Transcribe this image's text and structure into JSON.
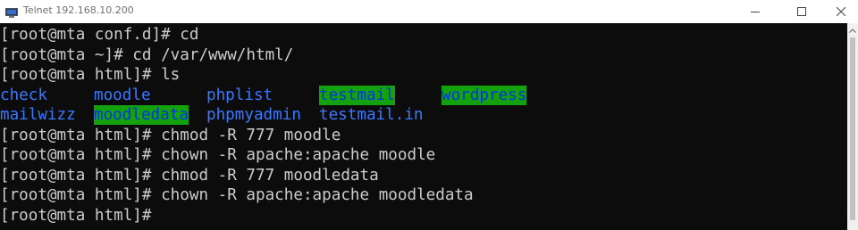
{
  "window": {
    "title": "Telnet 192.168.10.200"
  },
  "terminal": {
    "colors": {
      "background": "#0c0c0c",
      "text": "#cccccc",
      "directory": "#3b78ff",
      "highlight_bg": "#13a10e",
      "highlight_fg": "#0037da"
    },
    "lines_before": [
      "[root@mta conf.d]# cd",
      "[root@mta ~]# cd /var/www/html/",
      "[root@mta html]# ls"
    ],
    "ls_rows": [
      [
        {
          "name": "check",
          "highlight": false
        },
        {
          "name": "moodle",
          "highlight": false
        },
        {
          "name": "phplist",
          "highlight": false
        },
        {
          "name": "testmail",
          "highlight": true
        },
        {
          "name": "wordpress",
          "highlight": true
        }
      ],
      [
        {
          "name": "mailwizz",
          "highlight": false
        },
        {
          "name": "moodledata",
          "highlight": true
        },
        {
          "name": "phpmyadmin",
          "highlight": false
        },
        {
          "name": "testmail.in",
          "highlight": false
        }
      ]
    ],
    "lines_after": [
      "[root@mta html]# chmod -R 777 moodle",
      "[root@mta html]# chown -R apache:apache moodle",
      "[root@mta html]# chmod -R 777 moodledata",
      "[root@mta html]# chown -R apache:apache moodledata",
      "[root@mta html]# "
    ]
  }
}
